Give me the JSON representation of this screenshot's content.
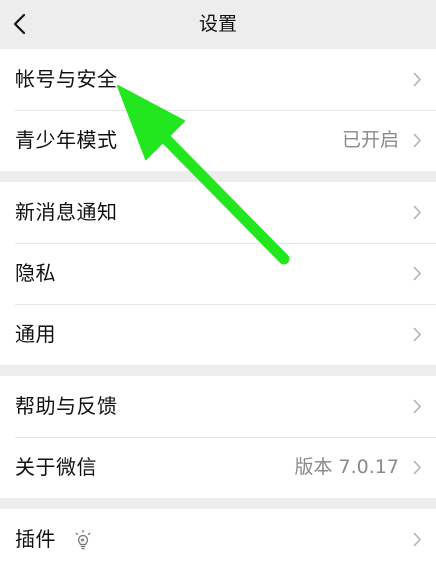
{
  "header": {
    "title": "设置",
    "back_icon": "chevron-left-icon"
  },
  "groups": [
    {
      "items": [
        {
          "label": "帐号与安全",
          "value": ""
        },
        {
          "label": "青少年模式",
          "value": "已开启"
        }
      ]
    },
    {
      "items": [
        {
          "label": "新消息通知",
          "value": ""
        },
        {
          "label": "隐私",
          "value": ""
        },
        {
          "label": "通用",
          "value": ""
        }
      ]
    },
    {
      "items": [
        {
          "label": "帮助与反馈",
          "value": ""
        },
        {
          "label": "关于微信",
          "value": "版本 7.0.17"
        }
      ]
    },
    {
      "items": [
        {
          "label": "插件",
          "value": "",
          "icon": "lightbulb-icon"
        }
      ]
    }
  ],
  "annotation": {
    "type": "arrow",
    "color": "#22e61e",
    "points_to": "帐号与安全"
  },
  "colors": {
    "background": "#ededed",
    "row": "#ffffff",
    "text": "#111111",
    "secondary": "#8a8a8a",
    "chevron": "#b2b2b2"
  }
}
